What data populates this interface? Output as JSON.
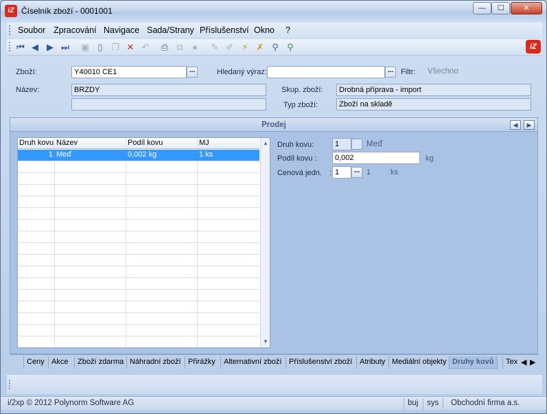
{
  "window": {
    "title": "Číselník zboží - 0001001",
    "app_badge": "iZ"
  },
  "menu": [
    "Soubor",
    "Zpracování",
    "Navigace",
    "Sada/Strany",
    "Příslušenství",
    "Okno",
    "?"
  ],
  "toolbar": {
    "icons": [
      "first-icon",
      "prev-icon",
      "next-icon",
      "last-icon",
      "save-icon",
      "new-icon",
      "copy-icon",
      "delete-icon",
      "undo-icon",
      "print-icon",
      "tree-icon",
      "disabled-icon",
      "edit-icon",
      "edit-disabled-icon",
      "filter-icon",
      "filter-clear-icon",
      "search-icon",
      "search-advanced-icon"
    ],
    "brand": "iZ"
  },
  "form": {
    "zbozi_label": "Zboží:",
    "zbozi_value": "Y40010 CE1",
    "hledany_label": "Hledaný výraz:",
    "hledany_value": "",
    "filtr_label": "Filtr:",
    "filtr_value": "Všechno",
    "nazev_label": "Název:",
    "nazev_value": "BRZDY",
    "nazev_value2": "",
    "skup_label": "Skup. zboží:",
    "skup_value": "Drobná příprava - import",
    "typ_label": "Typ zboží:",
    "typ_value": "Zboží na skladě",
    "ellipsis": "..."
  },
  "panel": {
    "title": "Prodej",
    "grid": {
      "columns": [
        "Druh kovu",
        "Název",
        "Podíl kovu",
        "MJ"
      ],
      "rows": [
        {
          "druh": "1",
          "nazev": "Meď",
          "podil": "0,002 kg",
          "mj": "1 ks"
        }
      ]
    },
    "detail": {
      "druh_label": "Druh kovu:",
      "druh_value": "1",
      "druh_name": "Meď",
      "podil_label": "Podíl kovu  :",
      "podil_value": "0,002",
      "podil_unit": "kg",
      "cenova_label": "Cenová jedn.",
      "cenova_colon": ":",
      "cenova_value": "1",
      "cenova_qty": "1",
      "cenova_unit": "ks"
    }
  },
  "tabs": [
    "Ceny",
    "Akce",
    "Zboží zdarma",
    "Náhradní zboží",
    "Přirážky",
    "Alternativní zboží",
    "Příslušenství zboží",
    "Atributy",
    "Mediální objekty",
    "Druhy kovů",
    "Tex"
  ],
  "active_tab": "Druhy kovů",
  "status": {
    "copyright": "i/2xp © 2012 Polynorm Software AG",
    "user": "buj",
    "db": "sys",
    "company": "Obchodní firma a.s."
  }
}
